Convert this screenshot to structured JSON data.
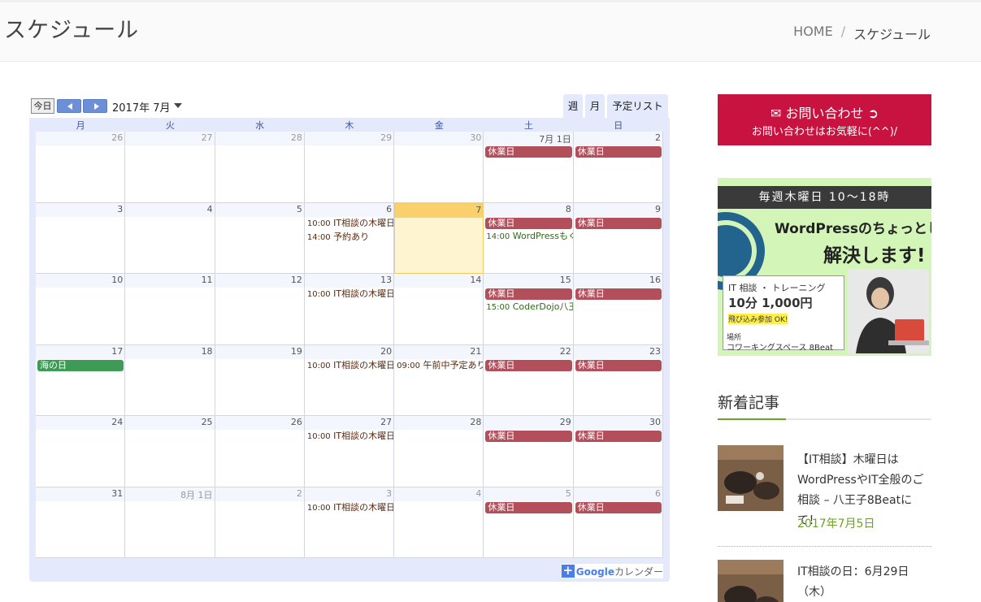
{
  "header": {
    "title": "スケジュール",
    "breadcrumb": {
      "home": "HOME",
      "separator": "/",
      "current": "スケジュール"
    }
  },
  "calendar": {
    "today_button": "今日",
    "month_label": "2017年 7月",
    "tabs": {
      "week": "週",
      "month": "月",
      "agenda": "予定リスト"
    },
    "weekdays": [
      "月",
      "火",
      "水",
      "木",
      "金",
      "土",
      "日"
    ],
    "weeks": [
      [
        {
          "label": "26",
          "other": true,
          "events": []
        },
        {
          "label": "27",
          "other": true,
          "events": []
        },
        {
          "label": "28",
          "other": true,
          "events": []
        },
        {
          "label": "29",
          "other": true,
          "events": []
        },
        {
          "label": "30",
          "other": true,
          "events": []
        },
        {
          "label": "7月 1日",
          "events": [
            {
              "kind": "bar",
              "color": "red",
              "title": "休業日"
            }
          ]
        },
        {
          "label": "2",
          "events": [
            {
              "kind": "bar",
              "color": "red",
              "title": "休業日"
            }
          ]
        }
      ],
      [
        {
          "label": "3",
          "events": []
        },
        {
          "label": "4",
          "events": []
        },
        {
          "label": "5",
          "events": []
        },
        {
          "label": "6",
          "events": [
            {
              "kind": "text",
              "time": "10:00",
              "title": "IT相談の木曜日"
            },
            {
              "kind": "text",
              "time": "14:00",
              "title": "予約あり"
            }
          ]
        },
        {
          "label": "7",
          "today": true,
          "events": []
        },
        {
          "label": "8",
          "events": [
            {
              "kind": "bar",
              "color": "red",
              "title": "休業日"
            },
            {
              "kind": "text",
              "color": "green",
              "time": "14:00",
              "title": "WordPressもく"
            }
          ]
        },
        {
          "label": "9",
          "events": [
            {
              "kind": "bar",
              "color": "red",
              "title": "休業日"
            }
          ]
        }
      ],
      [
        {
          "label": "10",
          "events": []
        },
        {
          "label": "11",
          "events": []
        },
        {
          "label": "12",
          "events": []
        },
        {
          "label": "13",
          "events": [
            {
              "kind": "text",
              "time": "10:00",
              "title": "IT相談の木曜日"
            }
          ]
        },
        {
          "label": "14",
          "events": []
        },
        {
          "label": "15",
          "events": [
            {
              "kind": "bar",
              "color": "red",
              "title": "休業日"
            },
            {
              "kind": "text",
              "color": "green",
              "time": "15:00",
              "title": "CoderDojo八王"
            }
          ]
        },
        {
          "label": "16",
          "events": [
            {
              "kind": "bar",
              "color": "red",
              "title": "休業日"
            }
          ]
        }
      ],
      [
        {
          "label": "17",
          "events": [
            {
              "kind": "bar",
              "color": "green",
              "title": "海の日"
            }
          ]
        },
        {
          "label": "18",
          "events": []
        },
        {
          "label": "19",
          "events": []
        },
        {
          "label": "20",
          "events": [
            {
              "kind": "text",
              "time": "10:00",
              "title": "IT相談の木曜日"
            }
          ]
        },
        {
          "label": "21",
          "events": [
            {
              "kind": "text",
              "time": "09:00",
              "title": "午前中予定あり"
            }
          ]
        },
        {
          "label": "22",
          "events": [
            {
              "kind": "bar",
              "color": "red",
              "title": "休業日"
            }
          ]
        },
        {
          "label": "23",
          "events": [
            {
              "kind": "bar",
              "color": "red",
              "title": "休業日"
            }
          ]
        }
      ],
      [
        {
          "label": "24",
          "events": []
        },
        {
          "label": "25",
          "events": []
        },
        {
          "label": "26",
          "events": []
        },
        {
          "label": "27",
          "events": [
            {
              "kind": "text",
              "time": "10:00",
              "title": "IT相談の木曜日"
            }
          ]
        },
        {
          "label": "28",
          "events": []
        },
        {
          "label": "29",
          "events": [
            {
              "kind": "bar",
              "color": "red",
              "title": "休業日"
            }
          ]
        },
        {
          "label": "30",
          "events": [
            {
              "kind": "bar",
              "color": "red",
              "title": "休業日"
            }
          ]
        }
      ],
      [
        {
          "label": "31",
          "events": []
        },
        {
          "label": "8月 1日",
          "other": true,
          "events": []
        },
        {
          "label": "2",
          "other": true,
          "events": []
        },
        {
          "label": "3",
          "other": true,
          "events": [
            {
              "kind": "text",
              "time": "10:00",
              "title": "IT相談の木曜日"
            }
          ]
        },
        {
          "label": "4",
          "other": true,
          "events": []
        },
        {
          "label": "5",
          "other": true,
          "events": [
            {
              "kind": "bar",
              "color": "red",
              "title": "休業日"
            }
          ]
        },
        {
          "label": "6",
          "other": true,
          "events": [
            {
              "kind": "bar",
              "color": "red",
              "title": "休業日"
            }
          ]
        }
      ]
    ],
    "google_link": {
      "plus": "+",
      "google": "Google",
      "suffix": "カレンダー"
    }
  },
  "sidebar": {
    "contact": {
      "title": "お問い合わせ",
      "subtitle": "お問い合わせはお気軽に(^^)/"
    },
    "banner": {
      "top": "毎週木曜日 10〜18時",
      "headline": "WordPressのちょっとした悩みを",
      "solve": "解決します!",
      "line1": "IT 相談 ・ トレーニング",
      "price": "10分 1,000円",
      "walkin": "飛び込み参加 OK!",
      "place_label": "場所",
      "place": "コワーキングスペース 8Beat"
    },
    "recent": {
      "heading": "新着記事",
      "posts": [
        {
          "title": "【IT相談】木曜日はWordPressやIT全般のご相談 – 八王子8Beatにて！",
          "date": "2017年7月5日"
        },
        {
          "title": "IT相談の日：6月29日（木）",
          "date": ""
        }
      ]
    }
  },
  "colors": {
    "accent_red": "#c8123f",
    "holiday_bar": "#b34f5b",
    "green_date": "#6ca12a",
    "cal_blue": "#e4e9fb"
  }
}
